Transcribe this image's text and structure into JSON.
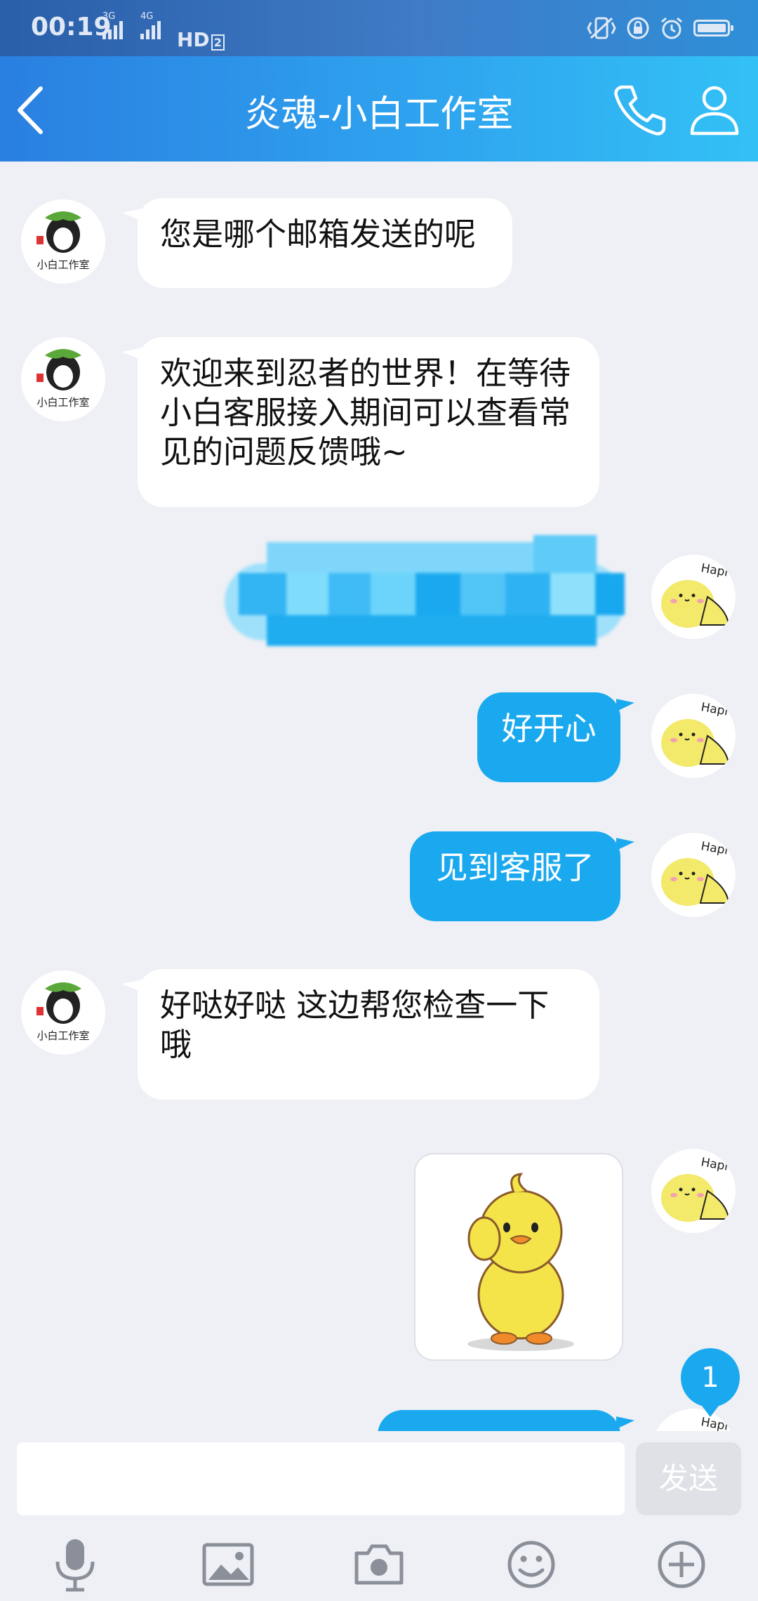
{
  "status_bar": {
    "time": "00:19",
    "net1": "3G",
    "net2": "4G",
    "hd": "HD",
    "hd_num": "2"
  },
  "header": {
    "title": "炎魂-小白工作室"
  },
  "avatars": {
    "studio_caption": "小白工作室",
    "chick_caption": "Hapi"
  },
  "messages": [
    {
      "side": "left",
      "text": "您是哪个邮箱发送的呢"
    },
    {
      "side": "left",
      "text": "欢迎来到忍者的世界！在等待小白客服接入期间可以查看常见的问题反馈哦~"
    },
    {
      "side": "right",
      "text": ""
    },
    {
      "side": "right",
      "text": "好开心"
    },
    {
      "side": "right",
      "text": "见到客服了"
    },
    {
      "side": "left",
      "text": "好哒好哒 这边帮您检查一下哦"
    },
    {
      "side": "right",
      "text": ""
    },
    {
      "side": "right",
      "text": ""
    }
  ],
  "unread_count": "1",
  "input": {
    "placeholder": "",
    "send_label": "发送"
  },
  "toolbar": [
    "microphone-icon",
    "image-icon",
    "camera-icon",
    "emoji-icon",
    "plus-icon"
  ],
  "colors": {
    "accent": "#1aa9ef",
    "header_start": "#2a7fe0",
    "header_end": "#33c1f5",
    "background": "#eef0f5"
  }
}
